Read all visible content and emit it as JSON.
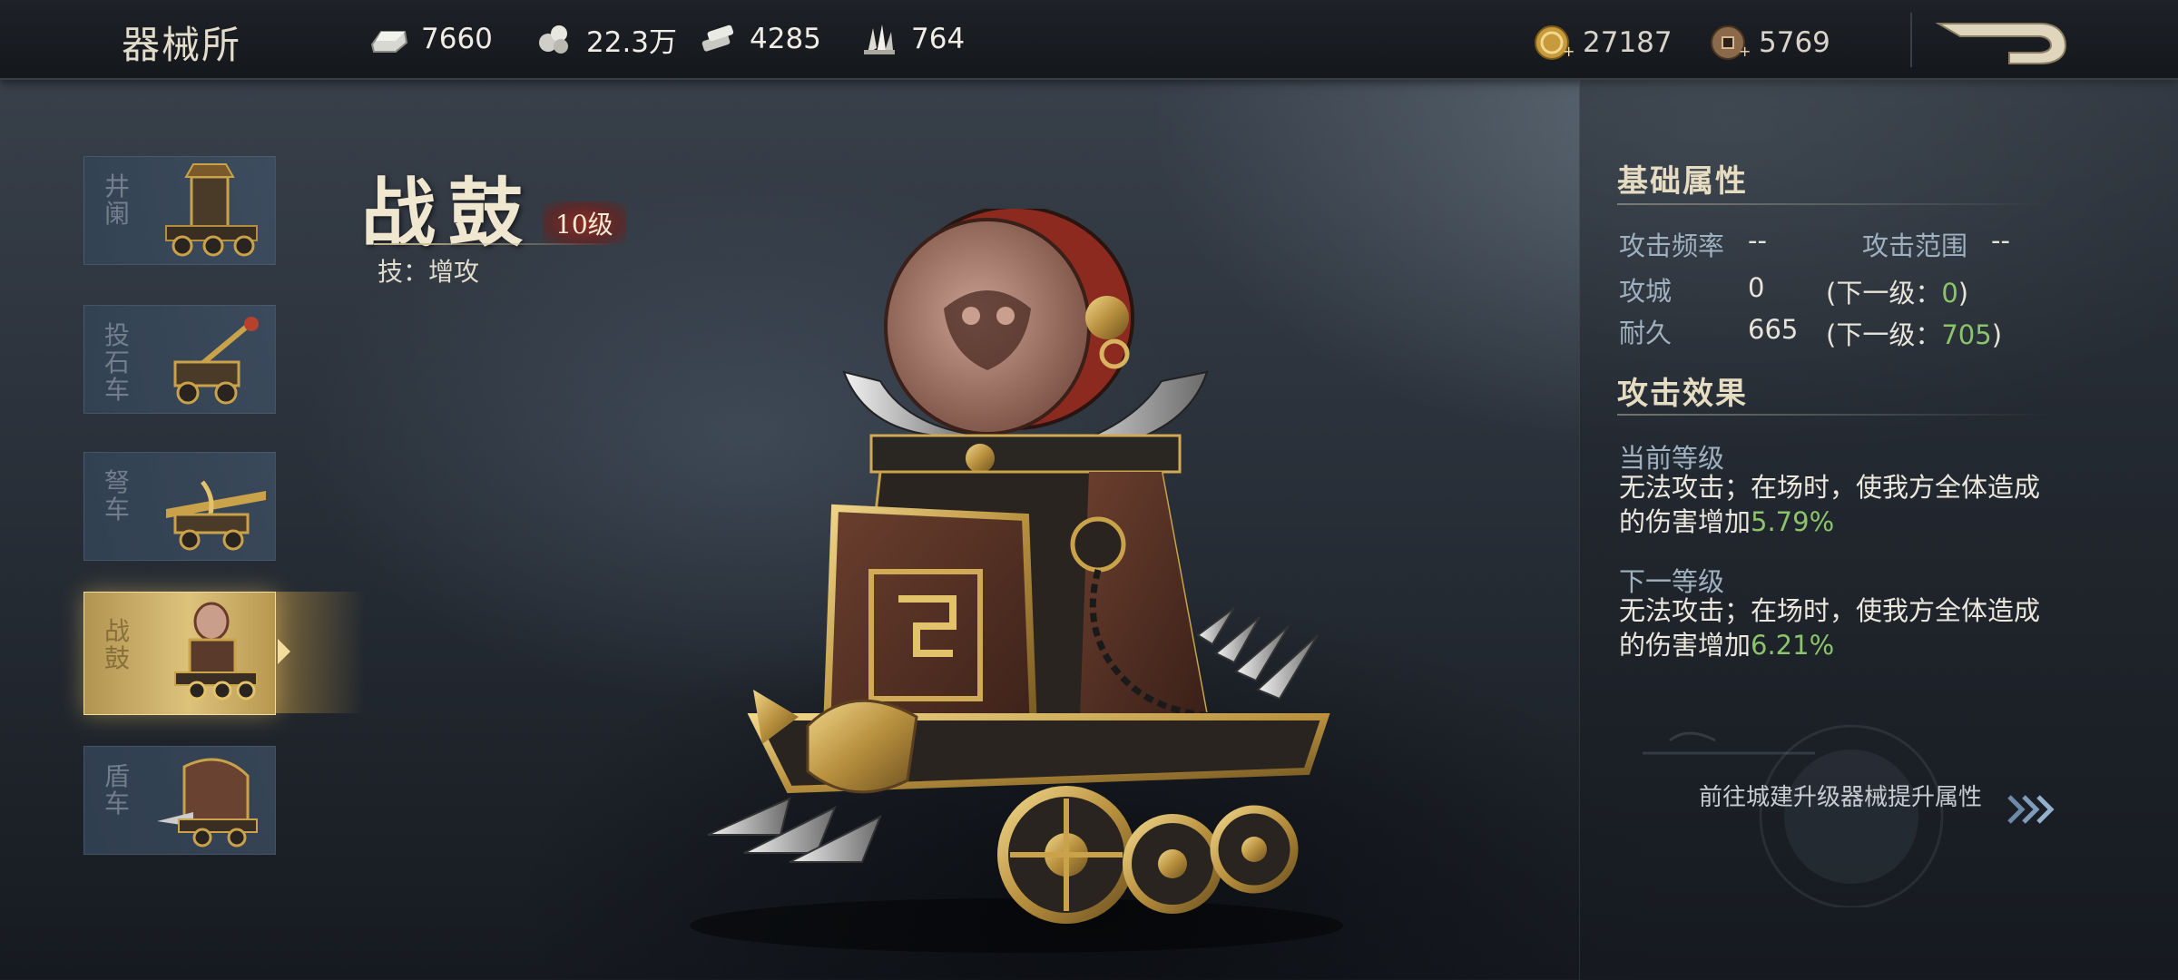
{
  "header": {
    "title": "器械所",
    "resources": [
      {
        "icon": "silver-ingot-icon",
        "value": "7660"
      },
      {
        "icon": "stone-icon",
        "value": "22.3万"
      },
      {
        "icon": "iron-icon",
        "value": "4285"
      },
      {
        "icon": "crystal-icon",
        "value": "764"
      }
    ],
    "coins": [
      {
        "icon": "gold-coin-icon",
        "value": "27187"
      },
      {
        "icon": "copper-coin-icon",
        "value": "5769"
      }
    ]
  },
  "weapons": [
    {
      "label": "井阑",
      "icon": "siege-tower-icon",
      "active": false
    },
    {
      "label": "投石车",
      "icon": "catapult-icon",
      "active": false
    },
    {
      "label": "弩车",
      "icon": "ballista-icon",
      "active": false
    },
    {
      "label": "战鼓",
      "icon": "war-drum-icon",
      "active": true
    },
    {
      "label": "盾车",
      "icon": "shield-cart-icon",
      "active": false
    }
  ],
  "selected": {
    "name": "战鼓",
    "level": "10级",
    "skill": "技：增攻"
  },
  "basic": {
    "title": "基础属性",
    "attack_rate_label": "攻击频率",
    "attack_rate_value": "--",
    "attack_range_label": "攻击范围",
    "attack_range_value": "--",
    "siege_label": "攻城",
    "siege_value": "0",
    "siege_next_prefix": "(下一级：",
    "siege_next_value": "0",
    "siege_next_suffix": ")",
    "durability_label": "耐久",
    "durability_value": "665",
    "durability_next_prefix": "(下一级：",
    "durability_next_value": "705",
    "durability_next_suffix": ")"
  },
  "effect": {
    "title": "攻击效果",
    "current_label": "当前等级",
    "current_text_1": "无法攻击；在场时，使我方全体造成",
    "current_text_2": "的伤害增加",
    "current_value": "5.79%",
    "next_label": "下一等级",
    "next_text_1": "无法攻击；在场时，使我方全体造成",
    "next_text_2": "的伤害增加",
    "next_value": "6.21%"
  },
  "goto_text": "前往城建升级器械提升属性",
  "colors": {
    "accent_gold": "#ddc27c",
    "highlight_green": "#8bc46a",
    "label_blue": "#9fb1c1"
  }
}
